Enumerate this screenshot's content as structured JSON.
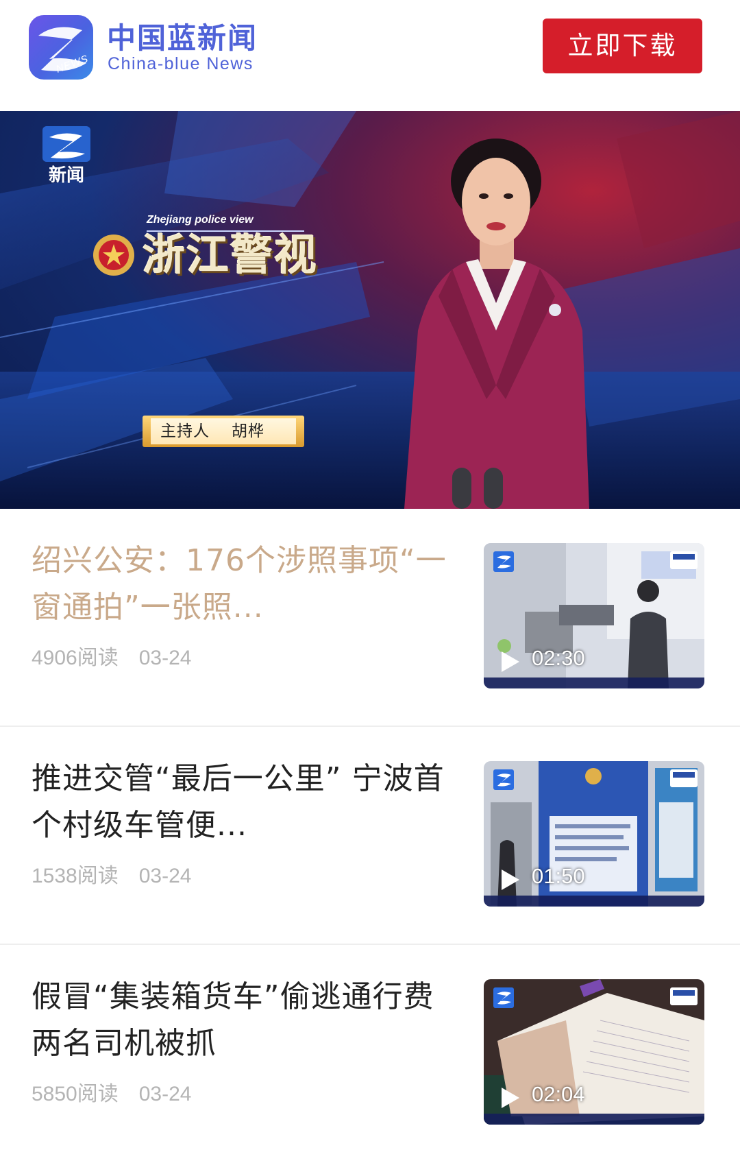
{
  "header": {
    "brand_cn": "中国蓝新闻",
    "brand_en": "China-blue News",
    "logo_badge": "NEWS",
    "download_label": "立即下载"
  },
  "hero": {
    "channel_text": "新闻",
    "show_en": "Zhejiang police view",
    "show_title": "浙江警视",
    "host_label": "主持人",
    "host_name": "胡桦"
  },
  "articles": [
    {
      "title": "绍兴公安：176个涉照事项“一窗通拍”一张照...",
      "reads": "4906阅读",
      "date": "03-24",
      "duration": "02:30",
      "visited": true
    },
    {
      "title": "推进交管“最后一公里” 宁波首个村级车管便...",
      "reads": "1538阅读",
      "date": "03-24",
      "duration": "01:50",
      "visited": false
    },
    {
      "title": "假冒“集装箱货车”偷逃通行费 两名司机被抓",
      "reads": "5850阅读",
      "date": "03-24",
      "duration": "02:04",
      "visited": false
    }
  ],
  "colors": {
    "brand_blue": "#4f62d8",
    "download_red": "#d51e2a",
    "visited_title": "#c9a98a",
    "meta_gray": "#b4b4b4"
  }
}
